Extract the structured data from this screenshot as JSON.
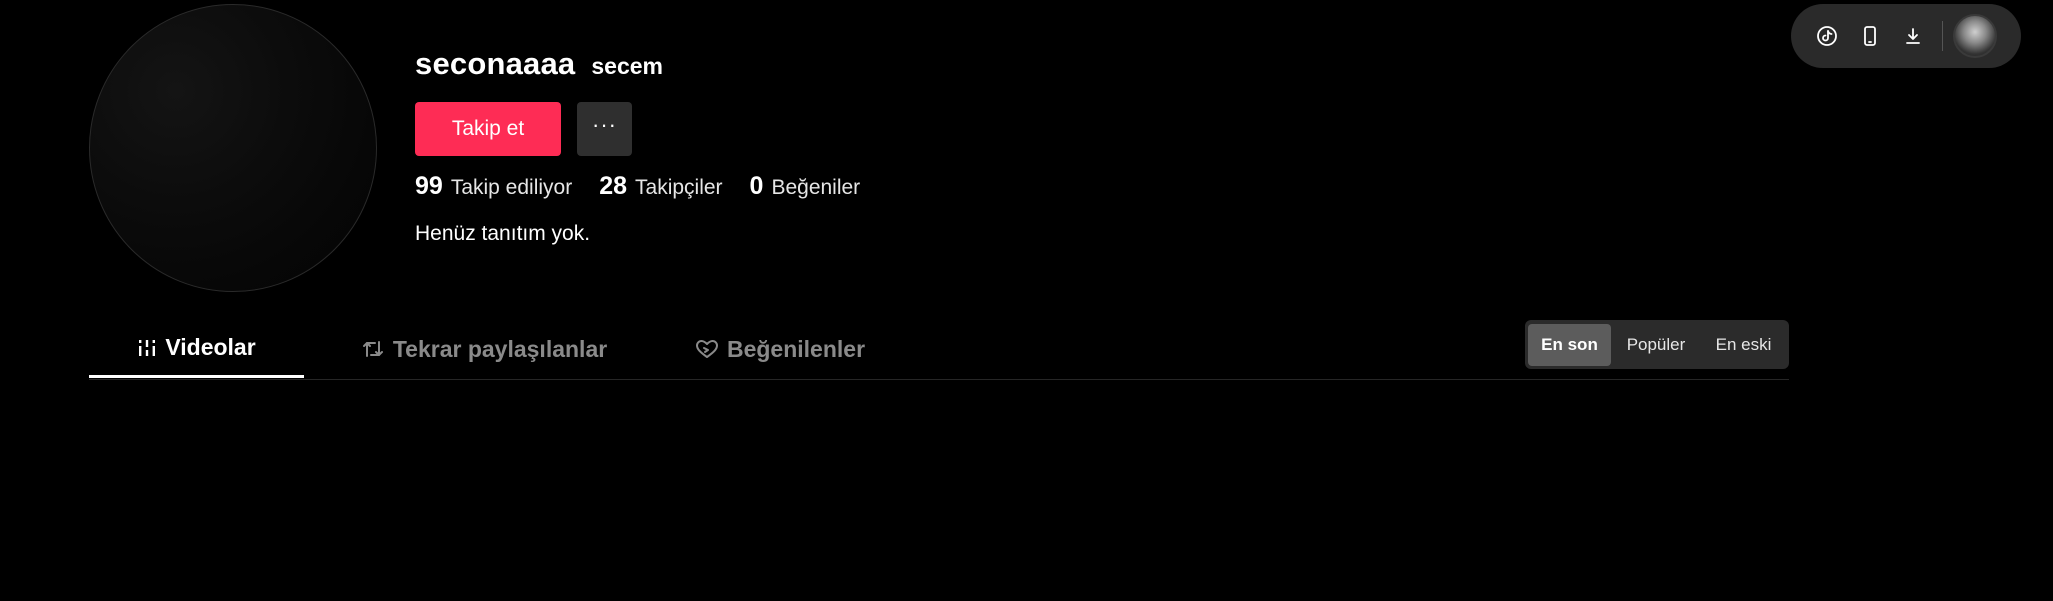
{
  "profile": {
    "username": "seconaaaa",
    "nickname": "secem",
    "follow_label": "Takip et",
    "more_label": "···",
    "bio": "Henüz tanıtım yok."
  },
  "stats": [
    {
      "value": "99",
      "label": "Takip ediliyor"
    },
    {
      "value": "28",
      "label": "Takipçiler"
    },
    {
      "value": "0",
      "label": "Beğeniler"
    }
  ],
  "tabs": [
    {
      "label": "Videolar",
      "icon": "grid-icon",
      "active": true
    },
    {
      "label": "Tekrar paylaşılanlar",
      "icon": "repost-icon",
      "active": false
    },
    {
      "label": "Beğenilenler",
      "icon": "heart-icon",
      "active": false
    }
  ],
  "sort": {
    "options": [
      "En son",
      "Popüler",
      "En eski"
    ],
    "selected": "En son"
  },
  "toolbar": {
    "icons": [
      "tiktok-coin-icon",
      "mobile-icon",
      "download-icon"
    ],
    "avatar": "user-avatar"
  },
  "colors": {
    "background": "#000000",
    "accent": "#fe2c55",
    "secondary_button": "#2f2f2f",
    "tab_inactive": "#8a8a8a"
  }
}
